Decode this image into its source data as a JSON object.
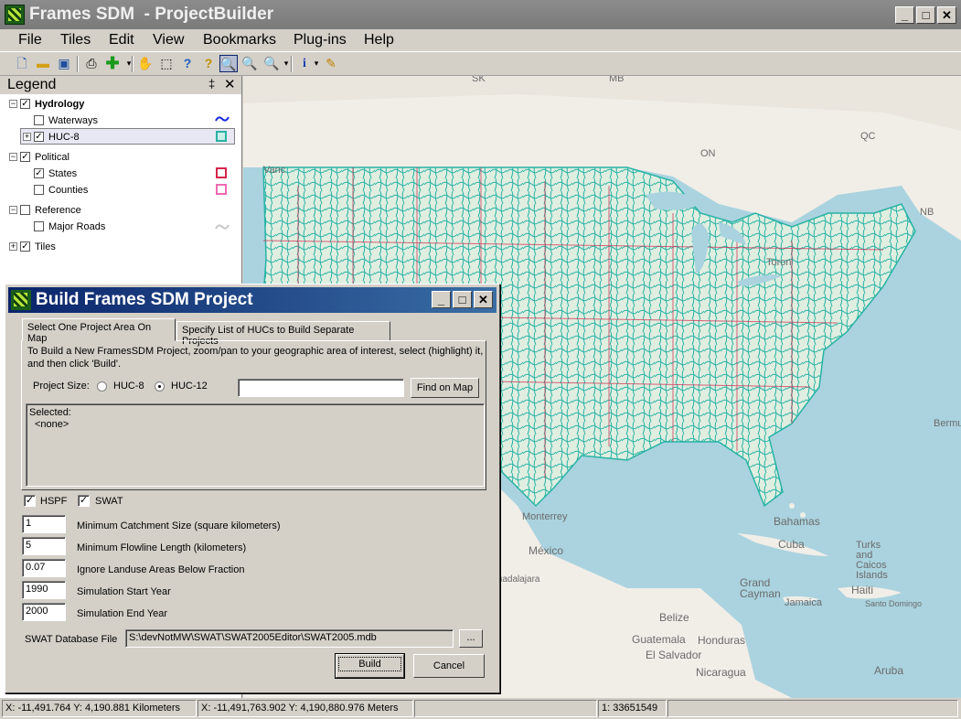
{
  "window": {
    "title": "Frames SDM  - ProjectBuilder",
    "minimize": "_",
    "maximize": "□",
    "close": "✕"
  },
  "menu": [
    "File",
    "Tiles",
    "Edit",
    "View",
    "Bookmarks",
    "Plug-ins",
    "Help"
  ],
  "toolbar_icons": [
    "new-icon",
    "open-icon",
    "save-icon",
    "print-icon",
    "add-layer-icon",
    "pan-icon",
    "select-icon",
    "identify-icon",
    "whats-this-icon",
    "zoom-in-icon",
    "zoom-out-icon",
    "zoom-extent-icon",
    "info-icon",
    "edit-icon"
  ],
  "legend": {
    "title": "Legend",
    "pin": "‡",
    "close": "✕",
    "groups": [
      {
        "label": "Hydrology",
        "checked": true,
        "bold": true,
        "layers": [
          {
            "label": "Waterways",
            "checked": false,
            "symbol": "wave",
            "color": "#1a2ee0"
          },
          {
            "label": "HUC-8",
            "checked": true,
            "symbol": "box",
            "color": "#27b3a5",
            "selected": true
          }
        ]
      },
      {
        "label": "Political",
        "checked": true,
        "layers": [
          {
            "label": "States",
            "checked": true,
            "symbol": "box",
            "color": "#d6234b"
          },
          {
            "label": "Counties",
            "checked": false,
            "symbol": "box",
            "color": "#ef6bb0"
          }
        ]
      },
      {
        "label": "Reference",
        "checked": false,
        "layers": [
          {
            "label": "Major Roads",
            "checked": false,
            "symbol": "wave",
            "color": "#c8c8c8"
          }
        ]
      },
      {
        "label": "Tiles",
        "checked": true,
        "layers": []
      }
    ]
  },
  "map_labels": [
    "SK",
    "MB",
    "ON",
    "QC",
    "NB",
    "Vanc",
    "Toron",
    "Bermu",
    "Monterrey",
    "México",
    "Guadalajara",
    "Bahamas",
    "Cuba",
    "Turks and Caicos Islands",
    "Grand Cayman",
    "Jamaica",
    "Haiti",
    "Santo Domingo",
    "Belize",
    "Guatemala",
    "Honduras",
    "El Salvador",
    "Nicaragua",
    "Aruba"
  ],
  "dialog": {
    "title": "Build Frames SDM Project",
    "tabs": [
      "Select One Project Area On Map",
      "Specify List of HUCs to Build Separate Projects"
    ],
    "instructions_line1": "To Build a New FramesSDM Project, zoom/pan to your geographic area of interest, select (highlight) it,",
    "instructions_line2": "and then click 'Build'.",
    "project_size_label": "Project Size:",
    "size_options": [
      "HUC-8",
      "HUC-12"
    ],
    "selected_size": "HUC-12",
    "find_value": "",
    "find_button": "Find on Map",
    "selected_label": "Selected:",
    "selected_value": "<none>",
    "hspf_label": "HSPF",
    "hspf_checked": true,
    "swat_label": "SWAT",
    "swat_checked": true,
    "params": [
      {
        "value": "1",
        "label": "Minimum Catchment Size (square kilometers)"
      },
      {
        "value": "5",
        "label": "Minimum Flowline Length (kilometers)"
      },
      {
        "value": "0.07",
        "label": "Ignore Landuse Areas Below Fraction"
      },
      {
        "value": "1990",
        "label": "Simulation Start Year"
      },
      {
        "value": "2000",
        "label": "Simulation End Year"
      }
    ],
    "swat_db_label": "SWAT Database File",
    "swat_db_value": "S:\\devNotMW\\SWAT\\SWAT2005Editor\\SWAT2005.mdb",
    "browse_label": "...",
    "build_label": "Build",
    "cancel_label": "Cancel"
  },
  "status": {
    "coords_km": "X: -11,491.764 Y: 4,190.881 Kilometers",
    "coords_m": "X: -11,491,763.902 Y: 4,190,880.976 Meters",
    "scale": "1: 33651549"
  },
  "colors": {
    "huc": "#27b3a5",
    "state": "#d6234b",
    "water": "#aad3df",
    "land": "#f1eee8",
    "titlebar": "#0a246a"
  }
}
